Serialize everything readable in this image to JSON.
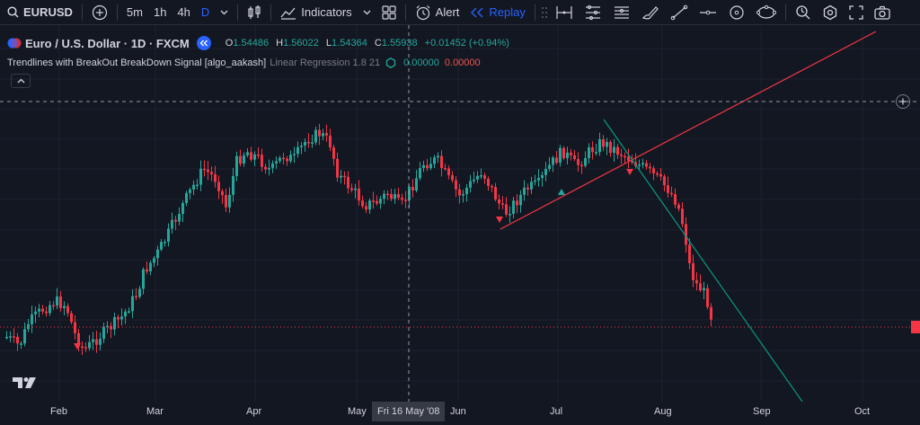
{
  "toolbar": {
    "symbol": "EURUSD",
    "intervals": [
      "5m",
      "1h",
      "4h",
      "D"
    ],
    "active_interval": "D",
    "indicators_label": "Indicators",
    "alert_label": "Alert",
    "replay_label": "Replay"
  },
  "legend": {
    "title": "Euro / U.S. Dollar · 1D · FXCM",
    "open_key": "O",
    "open": "1.54486",
    "high_key": "H",
    "high": "1.56022",
    "low_key": "L",
    "low": "1.54364",
    "close_key": "C",
    "close": "1.55938",
    "change": "+0.01452 (+0.94%)"
  },
  "indicator": {
    "name": "Trendlines with BreakOut BreakDown Signal [algo_aakash]",
    "params": "Linear Regression 1.8 21",
    "value1": "0.00000",
    "value2": "0.00000"
  },
  "xaxis": {
    "labels": [
      "Feb",
      "Mar",
      "Apr",
      "May",
      "Jun",
      "Jul",
      "Aug",
      "Sep",
      "Oct"
    ],
    "crosshair_label": "Fri 16 May '08"
  },
  "colors": {
    "background": "#131722",
    "up": "#26a69a",
    "down": "#f23645",
    "accent": "#2962ff",
    "trend_up": "#f23645",
    "trend_down": "#089981"
  }
}
